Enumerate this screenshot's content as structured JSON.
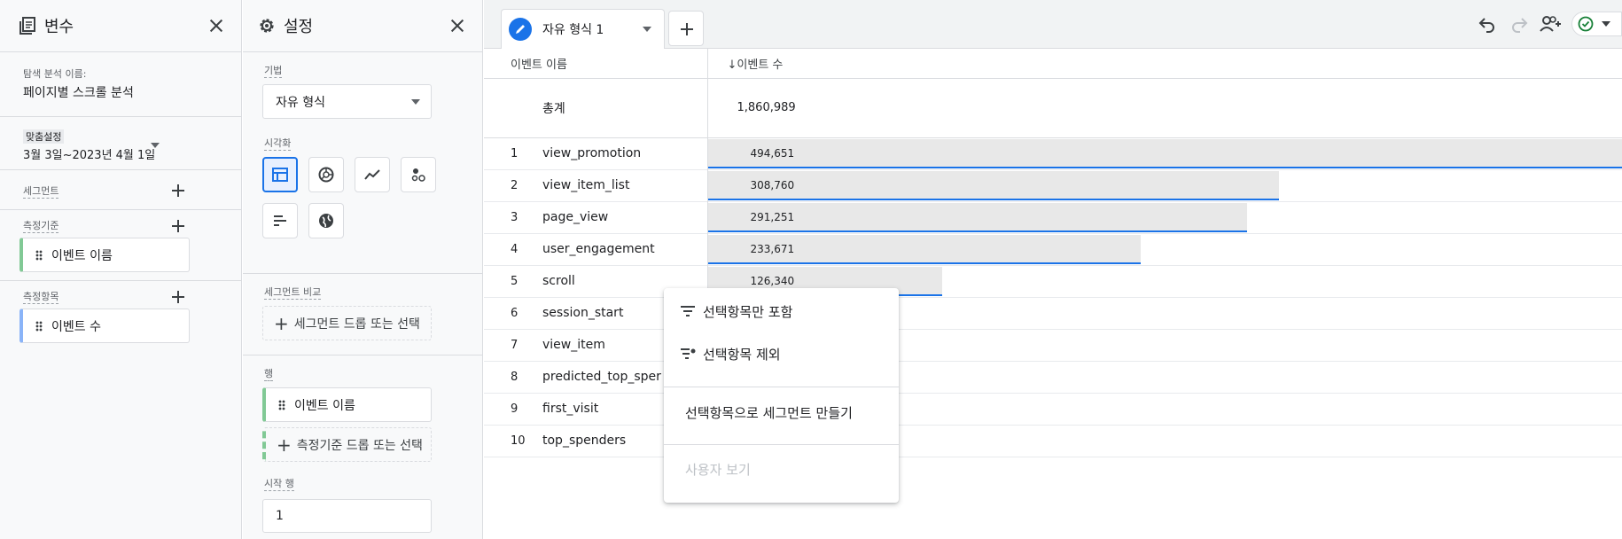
{
  "variables_panel": {
    "title": "변수",
    "exploration_name_label": "탐색 분석 이름:",
    "exploration_name": "페이지별 스크롤 분석",
    "date_label": "맞춤설정",
    "date_range": "3월 3일~2023년 4월 1일",
    "segments_label": "세그먼트",
    "dimensions_label": "측정기준",
    "dimension_chip": "이벤트 이름",
    "metrics_label": "측정항목",
    "metric_chip": "이벤트 수"
  },
  "settings_panel": {
    "title": "설정",
    "technique_label": "기법",
    "technique_value": "자유 형식",
    "visualization_label": "시각화",
    "segment_compare_label": "세그먼트 비교",
    "segment_drop_hint": "세그먼트 드롭 또는 선택",
    "rows_label": "행",
    "row_chip": "이벤트 이름",
    "dimension_drop_hint": "측정기준 드롭 또는 선택",
    "start_row_label": "시작 행",
    "start_row_value": "1"
  },
  "tab": {
    "label": "자유 형식 1"
  },
  "table": {
    "col_dimension": "이벤트 이름",
    "col_metric": "↓이벤트 수",
    "total_label": "총계",
    "total_value": "1,860,989",
    "rows": [
      {
        "idx": "1",
        "name": "view_promotion",
        "value": "494,651",
        "num": 494651
      },
      {
        "idx": "2",
        "name": "view_item_list",
        "value": "308,760",
        "num": 308760
      },
      {
        "idx": "3",
        "name": "page_view",
        "value": "291,251",
        "num": 291251
      },
      {
        "idx": "4",
        "name": "user_engagement",
        "value": "233,671",
        "num": 233671
      },
      {
        "idx": "5",
        "name": "scroll",
        "value": "126,340",
        "num": 126340
      },
      {
        "idx": "6",
        "name": "session_start",
        "value": "",
        "num": 0
      },
      {
        "idx": "7",
        "name": "view_item",
        "value": "",
        "num": 0
      },
      {
        "idx": "8",
        "name": "predicted_top_sper",
        "value": "",
        "num": 0
      },
      {
        "idx": "9",
        "name": "first_visit",
        "value": "",
        "num": 0
      },
      {
        "idx": "10",
        "name": "top_spenders",
        "value": "",
        "num": 0
      }
    ]
  },
  "context_menu": {
    "include_only": "선택항목만 포함",
    "exclude": "선택항목 제외",
    "create_segment": "선택항목으로 세그먼트 만들기",
    "view_users": "사용자 보기"
  },
  "colors": {
    "accent": "#1a73e8",
    "bar": "#e8e8e8",
    "dimension": "#81c995",
    "metric": "#8ab4f8"
  }
}
